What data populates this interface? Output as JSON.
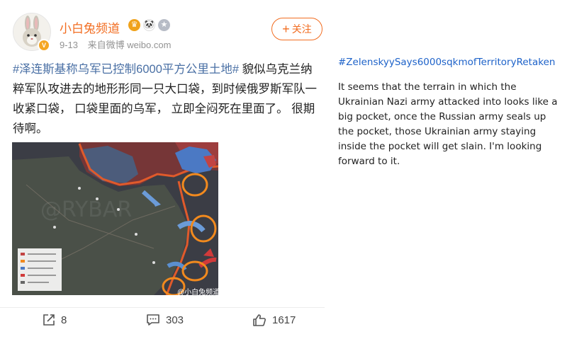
{
  "post": {
    "username": "小白兔频道",
    "date": "9-13",
    "source": "来自微博 weibo.com",
    "follow_label": "关注",
    "hashtag": "#泽连斯基称乌军已控制6000平方公里土地#",
    "body": " 貌似乌克兰纳粹军队攻进去的地形形同一只大口袋，到时候俄罗斯军队一收紧口袋， 口袋里面的乌军， 立即全闷死在里面了。 很期待啊。",
    "image_watermark": "@小白兔频道",
    "actions": {
      "share_count": "8",
      "comment_count": "303",
      "like_count": "1617"
    }
  },
  "caption": {
    "hashtag": "#ZelenskyySays6000sqkmofTerritoryRetaken",
    "translation": "It seems that the terrain in which the Ukrainian Nazi army attacked into looks like a big pocket, once the Russian army seals up the pocket, those Ukrainian army staying inside the pocket will get slain. I'm looking forward to it."
  },
  "colors": {
    "username": "#f26d21",
    "hashtag_cn": "#496fa4",
    "hashtag_en": "#1d62c9",
    "map_bg": "#3a3c44",
    "russian_zone": "#8c3b3b"
  },
  "icons": [
    "share-icon",
    "comment-icon",
    "like-icon",
    "plus-icon",
    "verified-badge-icon"
  ]
}
